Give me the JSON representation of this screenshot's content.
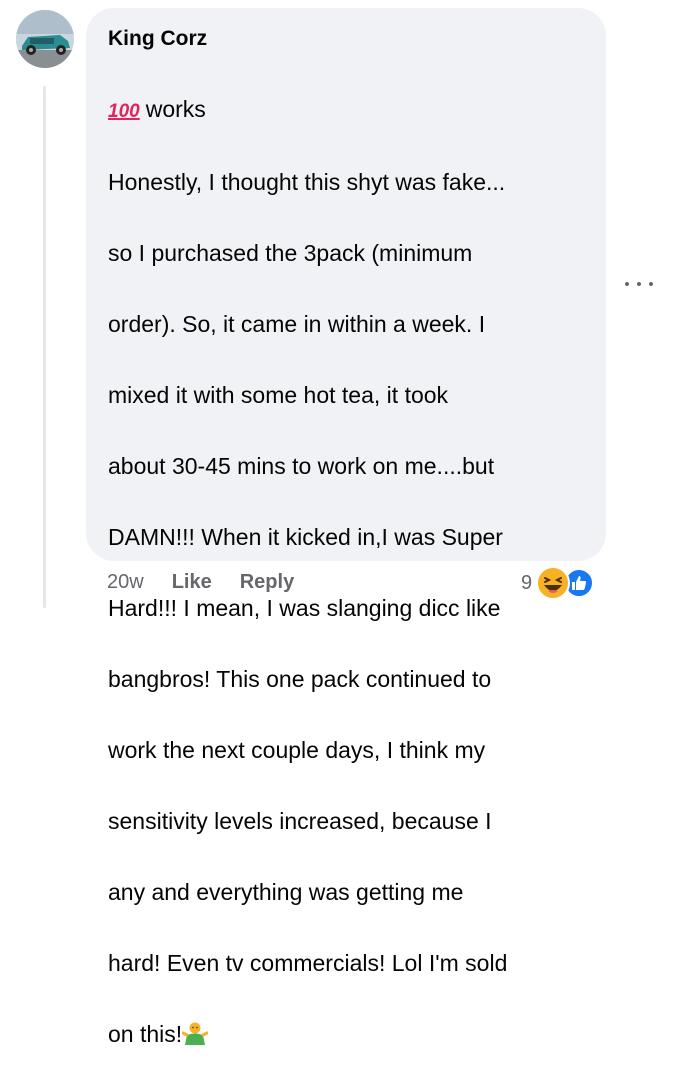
{
  "comment": {
    "author": "King Corz",
    "emoji_badge": "100",
    "first_line_text": "works",
    "body_lines": [
      "Honestly, I thought this shyt was fake...",
      "so I purchased the 3pack (minimum",
      "order). So, it came in within a week. I",
      "mixed it with some hot tea, it took",
      "about 30-45 mins to work on me....but",
      "DAMN!!! When it kicked in,I was Super",
      "Hard!!! I mean, I was slanging dicc like",
      "bangbros! This one pack continued to",
      "work the next couple days, I think my",
      "sensitivity levels increased, because I",
      "any and everything was getting me",
      "hard! Even tv commercials! Lol I'm sold"
    ],
    "last_line_text": "on this!"
  },
  "actions": {
    "time": "20w",
    "like": "Like",
    "reply": "Reply"
  },
  "reactions": {
    "count": "9",
    "types": [
      "haha-icon",
      "like-icon"
    ]
  },
  "colors": {
    "bubble": "#f0f2f5",
    "secondary_text": "#65676b",
    "like_blue": "#1877f2",
    "haha_yellow": "#f7b125"
  }
}
